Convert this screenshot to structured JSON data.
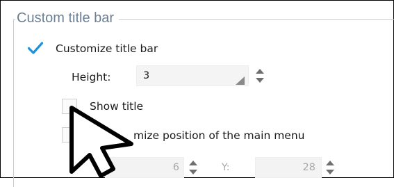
{
  "group": {
    "title": "Custom title bar"
  },
  "customize_title_bar": {
    "label": "Customize title bar",
    "checked": true
  },
  "height": {
    "label": "Height:",
    "value": "3"
  },
  "show_title": {
    "label": "Show title",
    "checked": false
  },
  "customize_menu_position": {
    "label": "Customize position of the main menu",
    "label_visible_part": "mize position of the main menu",
    "checked": false
  },
  "position": {
    "x_value": "6",
    "y_label": "Y:",
    "y_value": "28"
  },
  "colors": {
    "check_accent": "#1e90dc",
    "group_title": "#6d7f93",
    "disabled_text": "#a8a8a8"
  },
  "icons": {
    "spinner": "spinner-arrows-icon",
    "resize_grip": "resize-grip-icon",
    "cursor": "mouse-cursor-icon",
    "check": "checkmark-icon"
  }
}
